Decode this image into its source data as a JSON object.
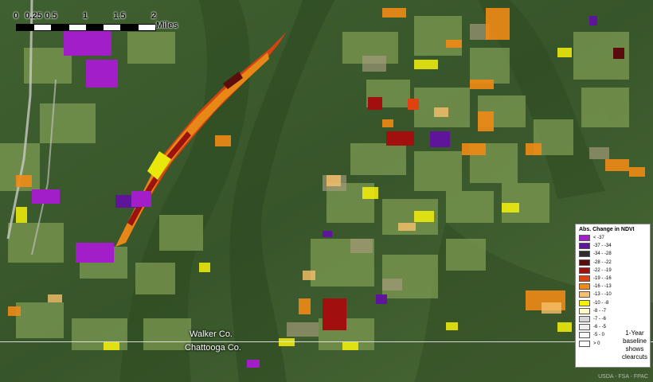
{
  "scale": {
    "ticks": [
      "0",
      "0.25",
      "0.5",
      "1",
      "1.5",
      "2"
    ],
    "units": "Miles"
  },
  "counties": {
    "north": "Walker Co.",
    "south": "Chattooga Co."
  },
  "legend": {
    "title": "Abs. Change in NDVI",
    "classes": [
      {
        "label": "< -37",
        "color": "#a11ec9"
      },
      {
        "label": "-37 - -34",
        "color": "#5e159a"
      },
      {
        "label": "-34 - -28",
        "color": "#2d2d2d"
      },
      {
        "label": "-28 - -22",
        "color": "#5a0c0c"
      },
      {
        "label": "-22 - -19",
        "color": "#a10f0f"
      },
      {
        "label": "-19 - -16",
        "color": "#e0410f"
      },
      {
        "label": "-16 - -13",
        "color": "#f08a16"
      },
      {
        "label": "-13 - -10",
        "color": "#f7c06a"
      },
      {
        "label": "-10 - -8",
        "color": "#f4f00a"
      },
      {
        "label": "-8 - -7",
        "color": "#fdf7c4"
      },
      {
        "label": "-7 - -6",
        "color": "#d6d6d6"
      },
      {
        "label": "-6 - -5",
        "color": "#ededed"
      },
      {
        "label": "-5 - 0",
        "color": "#f7f7f7"
      },
      {
        "label": "> 0",
        "color": "#ffffff"
      }
    ],
    "note": "1-Year baseline shows clearcuts"
  },
  "credit": "USDA - FSA - FPAC"
}
